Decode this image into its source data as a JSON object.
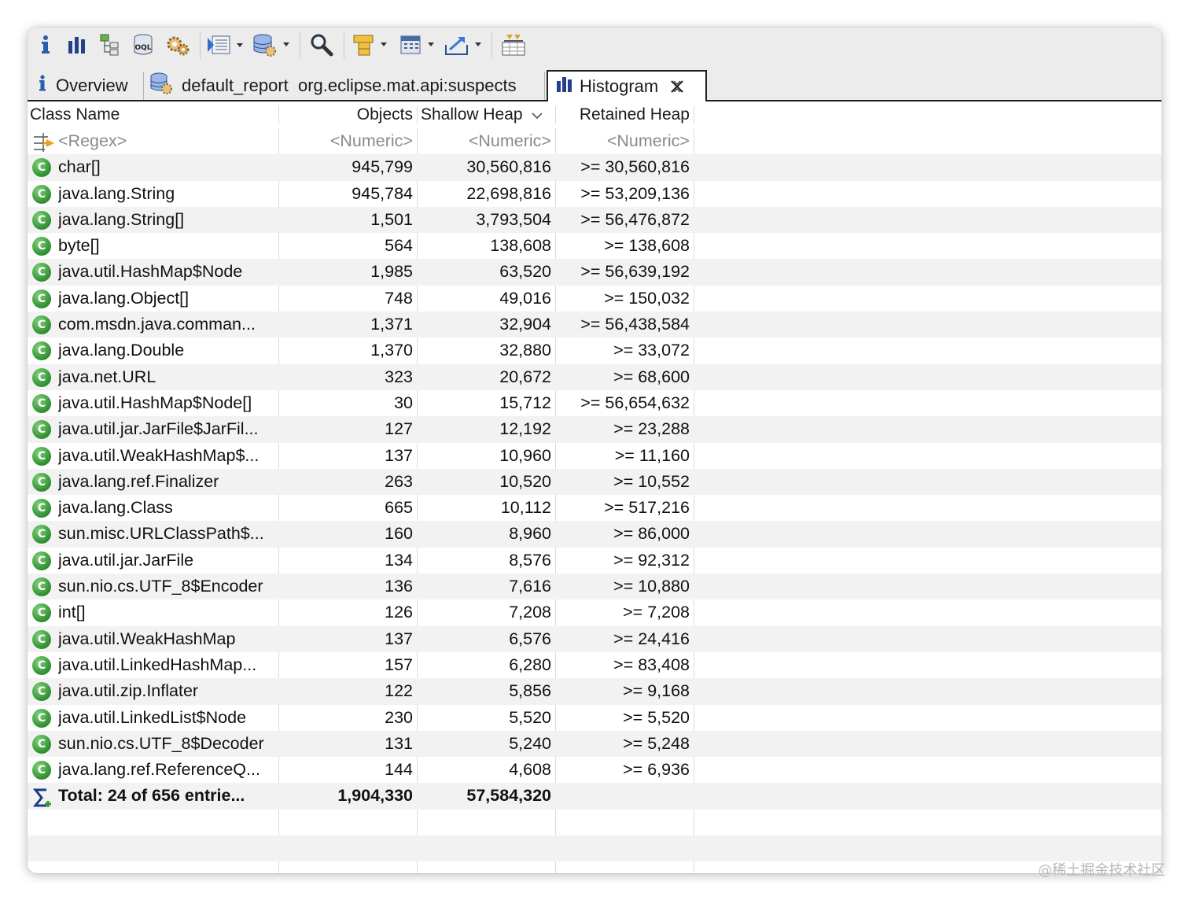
{
  "tabs": [
    {
      "label": "Overview",
      "icon": "info-icon",
      "active": false
    },
    {
      "label": "default_report  org.eclipse.mat.api:suspects",
      "icon": "report-icon",
      "active": false
    },
    {
      "label": "Histogram",
      "icon": "histogram-icon",
      "active": true
    }
  ],
  "toolbar": [
    "info-icon",
    "histogram-icon",
    "dominator-tree-icon",
    "oql-icon",
    "heap-dump-details-icon",
    "run-expert-system-icon",
    "query-browser-icon",
    "find-object-icon",
    "group-by-icon",
    "calculate-retained-size-icon",
    "export-icon",
    "pin-icon"
  ],
  "columns": {
    "class_name": "Class Name",
    "objects": "Objects",
    "shallow_heap": "Shallow Heap",
    "retained_heap": "Retained Heap"
  },
  "filter_row": {
    "class_name": "<Regex>",
    "objects": "<Numeric>",
    "shallow_heap": "<Numeric>",
    "retained_heap": "<Numeric>"
  },
  "rows": [
    {
      "name": "char[]",
      "objects": "945,799",
      "shallow": "30,560,816",
      "retained": ">= 30,560,816"
    },
    {
      "name": "java.lang.String",
      "objects": "945,784",
      "shallow": "22,698,816",
      "retained": ">= 53,209,136"
    },
    {
      "name": "java.lang.String[]",
      "objects": "1,501",
      "shallow": "3,793,504",
      "retained": ">= 56,476,872"
    },
    {
      "name": "byte[]",
      "objects": "564",
      "shallow": "138,608",
      "retained": ">= 138,608"
    },
    {
      "name": "java.util.HashMap$Node",
      "objects": "1,985",
      "shallow": "63,520",
      "retained": ">= 56,639,192"
    },
    {
      "name": "java.lang.Object[]",
      "objects": "748",
      "shallow": "49,016",
      "retained": ">= 150,032"
    },
    {
      "name": "com.msdn.java.comman...",
      "objects": "1,371",
      "shallow": "32,904",
      "retained": ">= 56,438,584"
    },
    {
      "name": "java.lang.Double",
      "objects": "1,370",
      "shallow": "32,880",
      "retained": ">= 33,072"
    },
    {
      "name": "java.net.URL",
      "objects": "323",
      "shallow": "20,672",
      "retained": ">= 68,600"
    },
    {
      "name": "java.util.HashMap$Node[]",
      "objects": "30",
      "shallow": "15,712",
      "retained": ">= 56,654,632"
    },
    {
      "name": "java.util.jar.JarFile$JarFil...",
      "objects": "127",
      "shallow": "12,192",
      "retained": ">= 23,288"
    },
    {
      "name": "java.util.WeakHashMap$...",
      "objects": "137",
      "shallow": "10,960",
      "retained": ">= 11,160"
    },
    {
      "name": "java.lang.ref.Finalizer",
      "objects": "263",
      "shallow": "10,520",
      "retained": ">= 10,552"
    },
    {
      "name": "java.lang.Class",
      "objects": "665",
      "shallow": "10,112",
      "retained": ">= 517,216"
    },
    {
      "name": "sun.misc.URLClassPath$...",
      "objects": "160",
      "shallow": "8,960",
      "retained": ">= 86,000"
    },
    {
      "name": "java.util.jar.JarFile",
      "objects": "134",
      "shallow": "8,576",
      "retained": ">= 92,312"
    },
    {
      "name": "sun.nio.cs.UTF_8$Encoder",
      "objects": "136",
      "shallow": "7,616",
      "retained": ">= 10,880"
    },
    {
      "name": "int[]",
      "objects": "126",
      "shallow": "7,208",
      "retained": ">= 7,208"
    },
    {
      "name": "java.util.WeakHashMap",
      "objects": "137",
      "shallow": "6,576",
      "retained": ">= 24,416"
    },
    {
      "name": "java.util.LinkedHashMap...",
      "objects": "157",
      "shallow": "6,280",
      "retained": ">= 83,408"
    },
    {
      "name": "java.util.zip.Inflater",
      "objects": "122",
      "shallow": "5,856",
      "retained": ">= 9,168"
    },
    {
      "name": "java.util.LinkedList$Node",
      "objects": "230",
      "shallow": "5,520",
      "retained": ">= 5,520"
    },
    {
      "name": "sun.nio.cs.UTF_8$Decoder",
      "objects": "131",
      "shallow": "5,240",
      "retained": ">= 5,248"
    },
    {
      "name": "java.lang.ref.ReferenceQ...",
      "objects": "144",
      "shallow": "4,608",
      "retained": ">= 6,936"
    }
  ],
  "total_row": {
    "name": "Total: 24 of 656 entrie...",
    "objects": "1,904,330",
    "shallow": "57,584,320",
    "retained": ""
  },
  "class_icon_letter": "C",
  "watermark": "@稀土掘金技术社区",
  "colors": {
    "class_icon": "#2f8f2f",
    "toolbar_bg": "#ececec",
    "alt_row": "#f2f2f2"
  }
}
